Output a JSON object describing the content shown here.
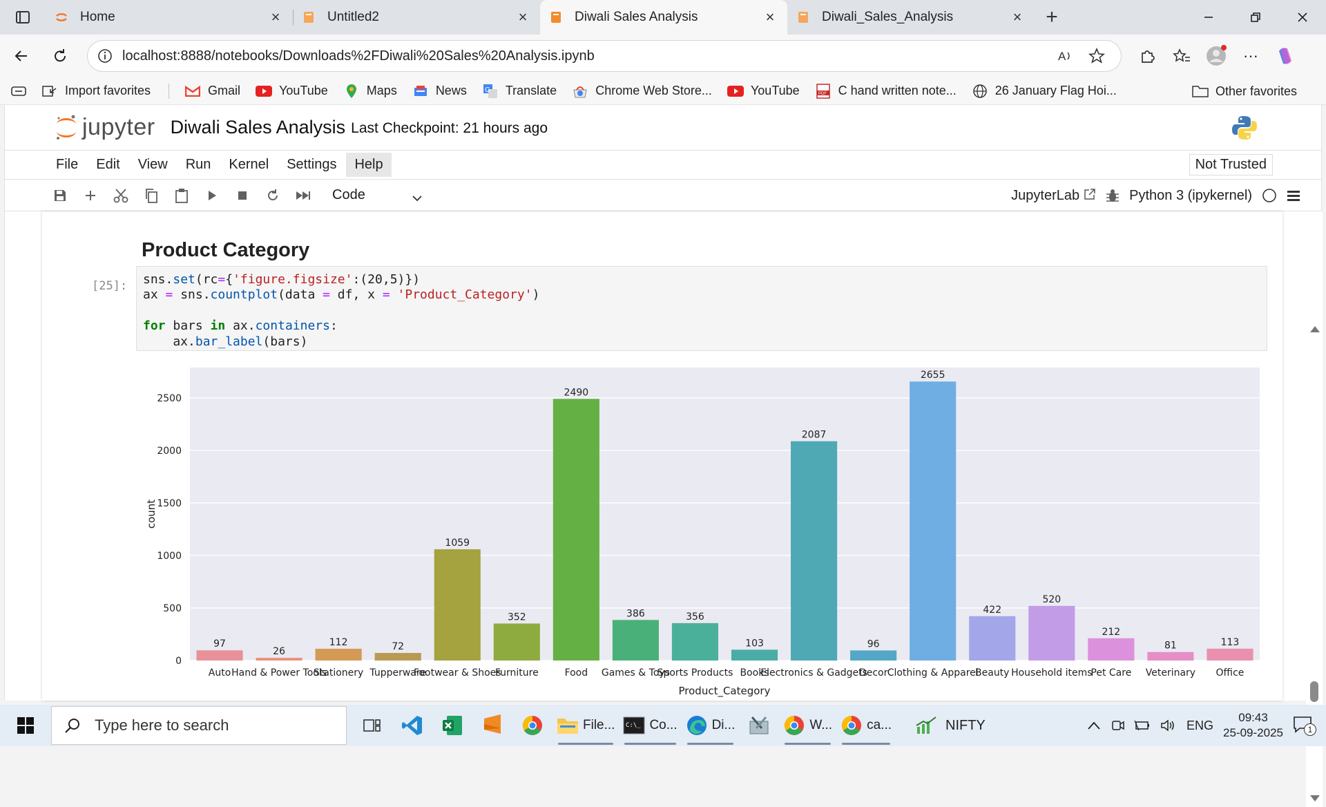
{
  "browser": {
    "tabs": [
      {
        "title": "Home",
        "active": false
      },
      {
        "title": "Untitled2",
        "active": false
      },
      {
        "title": "Diwali Sales Analysis",
        "active": true
      },
      {
        "title": "Diwali_Sales_Analysis",
        "active": false
      }
    ],
    "url": "localhost:8888/notebooks/Downloads%2FDiwali%20Sales%20Analysis.ipynb",
    "favorites": [
      "Import favorites",
      "Gmail",
      "YouTube",
      "Maps",
      "News",
      "Translate",
      "Chrome Web Store...",
      "YouTube",
      "C hand written note...",
      "26 January Flag Hoi..."
    ],
    "other_favorites": "Other favorites"
  },
  "jupyter": {
    "logo_text": "jupyter",
    "notebook_title": "Diwali Sales Analysis",
    "checkpoint": "Last Checkpoint: 21 hours ago",
    "menu": [
      "File",
      "Edit",
      "View",
      "Run",
      "Kernel",
      "Settings",
      "Help"
    ],
    "trust": "Not Trusted",
    "cell_type": "Code",
    "jupyterlab_label": "JupyterLab",
    "kernel": "Python 3 (ipykernel)"
  },
  "notebook": {
    "heading": "Product Category",
    "prompt": "[25]:"
  },
  "chart_data": {
    "type": "bar",
    "categories": [
      "Auto",
      "Hand & Power Tools",
      "Stationery",
      "Tupperware",
      "Footwear & Shoes",
      "Furniture",
      "Food",
      "Games & Toys",
      "Sports Products",
      "Books",
      "Electronics & Gadgets",
      "Decor",
      "Clothing & Apparel",
      "Beauty",
      "Household items",
      "Pet Care",
      "Veterinary",
      "Office"
    ],
    "values": [
      97,
      26,
      112,
      72,
      1059,
      352,
      2490,
      386,
      356,
      103,
      2087,
      96,
      2655,
      422,
      520,
      212,
      81,
      113
    ],
    "colors": [
      "#e8919a",
      "#e8937e",
      "#d49a55",
      "#b89a52",
      "#a5a240",
      "#8eab40",
      "#65b045",
      "#4ab079",
      "#4bb09a",
      "#4baca7",
      "#4ea9b5",
      "#54a7c6",
      "#6eaee2",
      "#a4a6ea",
      "#c39ce8",
      "#dc91dc",
      "#e58fc6",
      "#e990af"
    ],
    "xlabel": "Product_Category",
    "ylabel": "count",
    "yticks": [
      0,
      500,
      1000,
      1500,
      2000,
      2500
    ],
    "ylim": [
      0,
      2788
    ],
    "grid": true
  },
  "taskbar": {
    "search_placeholder": "Type here to search",
    "apps": [
      {
        "name": "task-view",
        "label": ""
      },
      {
        "name": "vscode",
        "label": ""
      },
      {
        "name": "excel",
        "label": ""
      },
      {
        "name": "sublime",
        "label": ""
      },
      {
        "name": "chrome",
        "label": ""
      },
      {
        "name": "file-explorer",
        "label": "File..."
      },
      {
        "name": "command-prompt",
        "label": "Co..."
      },
      {
        "name": "edge",
        "label": "Di..."
      },
      {
        "name": "tools",
        "label": ""
      },
      {
        "name": "chrome-w",
        "label": "W..."
      },
      {
        "name": "chrome-ca",
        "label": "ca..."
      }
    ],
    "ticker": "NIFTY",
    "language": "ENG",
    "time": "09:43",
    "date": "25-09-2025",
    "notifications": "1"
  }
}
